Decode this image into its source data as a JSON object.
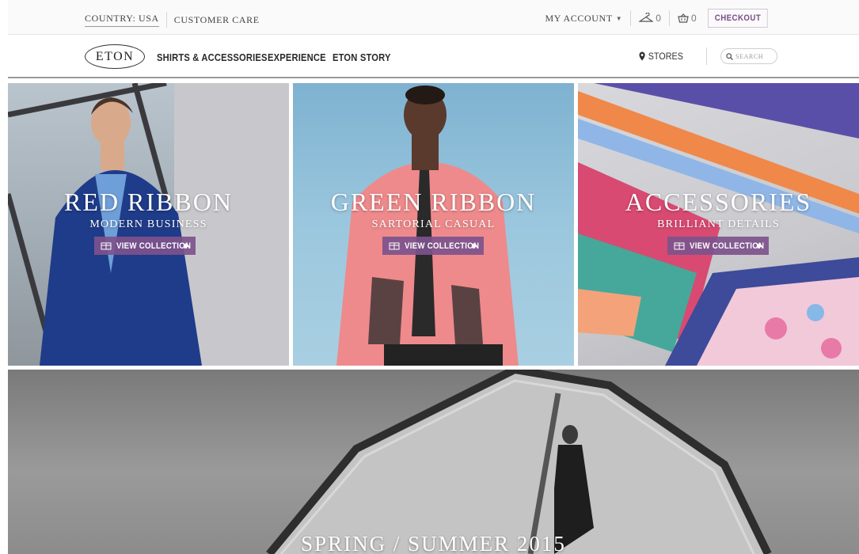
{
  "topbar": {
    "country_label": "COUNTRY: USA",
    "customer_care": "CUSTOMER CARE",
    "my_account": "MY ACCOUNT",
    "wishlist_count": "0",
    "basket_count": "0",
    "checkout": "CHECKOUT"
  },
  "nav": {
    "logo": "ETON",
    "links": [
      "SHIRTS & ACCESSORIES",
      "EXPERIENCE",
      "ETON STORY"
    ],
    "stores": "STORES",
    "search_placeholder": "SEARCH"
  },
  "panels": [
    {
      "title": "RED RIBBON",
      "subtitle": "MODERN BUSINESS",
      "cta": "VIEW COLLECTION"
    },
    {
      "title": "GREEN RIBBON",
      "subtitle": "SARTORIAL CASUAL",
      "cta": "VIEW COLLECTION"
    },
    {
      "title": "ACCESSORIES",
      "subtitle": "BRILLIANT DETAILS",
      "cta": "VIEW COLLECTION"
    }
  ],
  "hero": {
    "title": "SPRING / SUMMER 2015"
  },
  "colors": {
    "accent": "#7d538c",
    "checkout_text": "#7d4b8a",
    "nav_text": "#2a2a2a"
  },
  "icons": {
    "wishlist": "hanger-icon",
    "basket": "basket-icon",
    "stores": "location-pin-icon",
    "search": "search-icon",
    "view_collection": "shirt-icon"
  }
}
